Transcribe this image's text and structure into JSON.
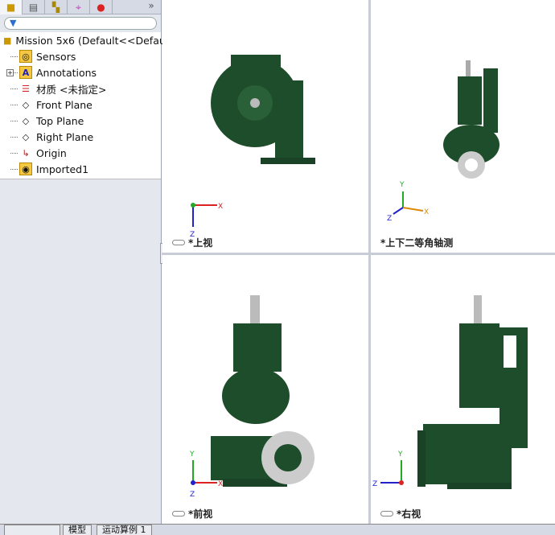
{
  "panel": {
    "tabs": [
      "feature-manager",
      "property-manager",
      "configuration-manager",
      "dimxpert-manager",
      "display-manager"
    ],
    "more": "»",
    "filter_icon": "filter-icon"
  },
  "tree": {
    "root": "Mission 5x6  (Default<<Defau",
    "items": [
      {
        "label": "Sensors",
        "icon": "sensors-icon"
      },
      {
        "label": "Annotations",
        "icon": "annotations-icon"
      },
      {
        "label": "材质 <未指定>",
        "icon": "material-icon"
      },
      {
        "label": "Front Plane",
        "icon": "plane-icon"
      },
      {
        "label": "Top Plane",
        "icon": "plane-icon"
      },
      {
        "label": "Right Plane",
        "icon": "plane-icon"
      },
      {
        "label": "Origin",
        "icon": "origin-icon"
      },
      {
        "label": "Imported1",
        "icon": "imported-icon"
      }
    ]
  },
  "viewports": [
    {
      "label": "*上视",
      "axes": [
        "X",
        "Z"
      ]
    },
    {
      "label": "*上下二等角轴测",
      "axes": [
        "Y",
        "X",
        "Z"
      ]
    },
    {
      "label": "*前视",
      "axes": [
        "Y",
        "X",
        "Z"
      ]
    },
    {
      "label": "*右视",
      "axes": [
        "Y",
        "Z"
      ]
    }
  ],
  "bottom_tabs": [
    "模型",
    "运动算例 1"
  ],
  "colors": {
    "part": "#1e4d2b",
    "panel": "#e4e7ee"
  }
}
